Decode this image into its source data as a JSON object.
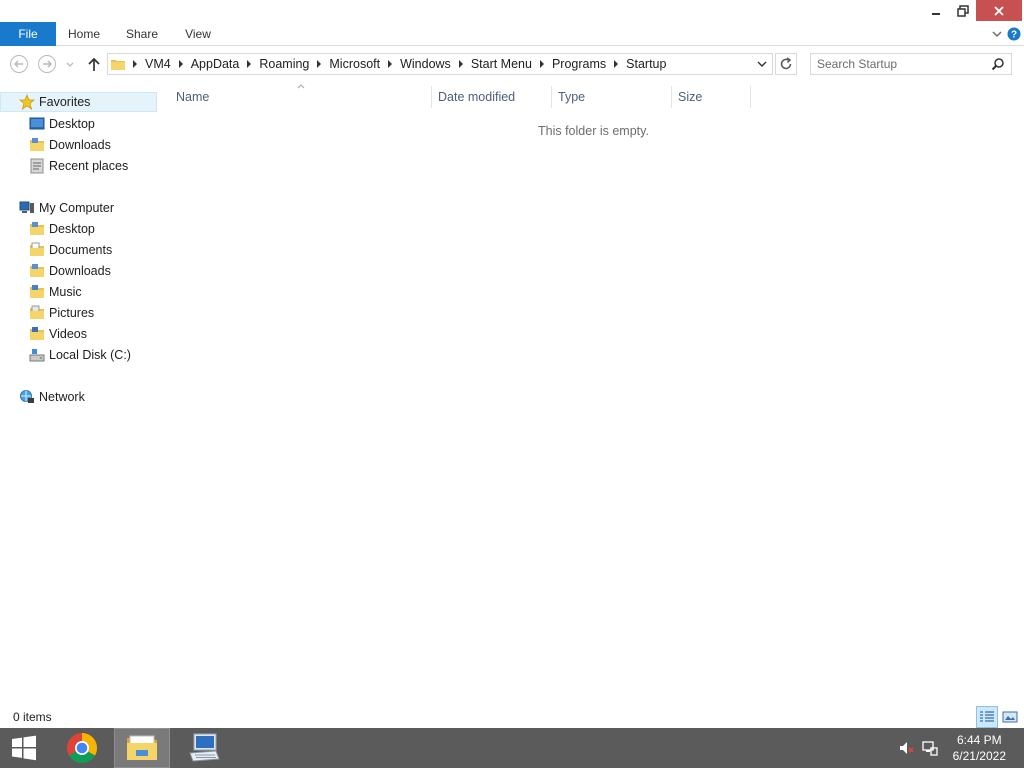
{
  "ribbon": {
    "tabs": [
      {
        "label": "File"
      },
      {
        "label": "Home"
      },
      {
        "label": "Share"
      },
      {
        "label": "View"
      }
    ]
  },
  "address": {
    "crumbs": [
      "VM4",
      "AppData",
      "Roaming",
      "Microsoft",
      "Windows",
      "Start Menu",
      "Programs",
      "Startup"
    ]
  },
  "search": {
    "placeholder": "Search Startup"
  },
  "navpane": {
    "favorites": {
      "label": "Favorites",
      "items": [
        {
          "label": "Desktop",
          "icon": "desktop-icon"
        },
        {
          "label": "Downloads",
          "icon": "downloads-folder-icon"
        },
        {
          "label": "Recent places",
          "icon": "recent-places-icon"
        }
      ]
    },
    "computer": {
      "label": "My Computer",
      "items": [
        {
          "label": "Desktop",
          "icon": "desktop-folder-icon"
        },
        {
          "label": "Documents",
          "icon": "documents-folder-icon"
        },
        {
          "label": "Downloads",
          "icon": "downloads-folder-icon"
        },
        {
          "label": "Music",
          "icon": "music-folder-icon"
        },
        {
          "label": "Pictures",
          "icon": "pictures-folder-icon"
        },
        {
          "label": "Videos",
          "icon": "videos-folder-icon"
        },
        {
          "label": "Local Disk (C:)",
          "icon": "local-disk-icon"
        }
      ]
    },
    "network": {
      "label": "Network"
    }
  },
  "content": {
    "columns": [
      "Name",
      "Date modified",
      "Type",
      "Size"
    ],
    "empty_message": "This folder is empty."
  },
  "status": {
    "item_count": "0 items"
  },
  "taskbar": {
    "time": "6:44 PM",
    "date": "6/21/2022"
  },
  "colors": {
    "accent": "#1979ca",
    "close": "#c75050",
    "taskbar": "#5b5b5b",
    "selected": "#e5f3fb"
  }
}
